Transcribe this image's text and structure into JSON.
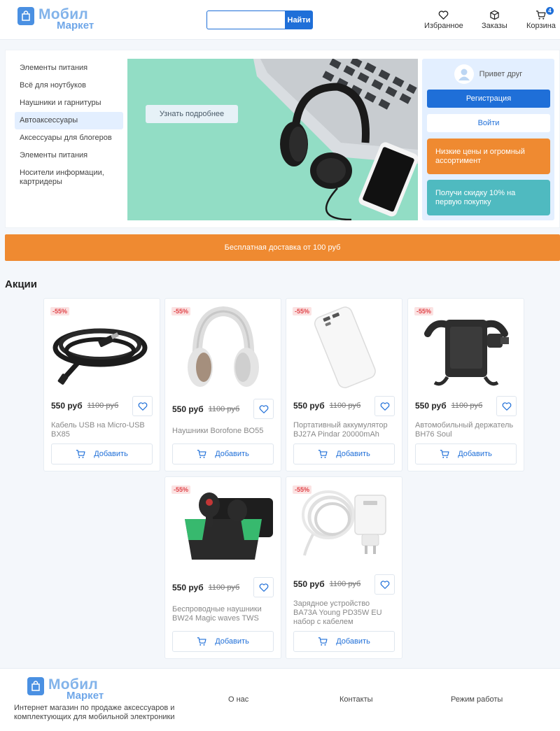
{
  "header": {
    "logo_line1": "Мобил",
    "logo_line2": "Маркет",
    "search_value": "",
    "search_button": "Найти",
    "favorites_label": "Избранное",
    "orders_label": "Заказы",
    "cart_label": "Корзина",
    "cart_count": "4"
  },
  "categories": [
    "Элементы питания",
    "Всё для ноутбуков",
    "Наушники и гарнитуры",
    "Автоаксессуары",
    "Аксессуары для блогеров",
    "Элементы питания",
    "Носители информации, картридеры"
  ],
  "active_category_index": 3,
  "banner": {
    "button_label": "Узнать подробнее"
  },
  "side_panel": {
    "greeting": "Привет друг",
    "register_label": "Регистрация",
    "login_label": "Войти",
    "promo1": "Низкие цены и огромный ассортимент",
    "promo2": "Получи скидку 10% на первую покупку"
  },
  "delivery_banner": "Бесплатная доставка от 100 руб",
  "section_title": "Акции",
  "products": [
    {
      "discount": "-55%",
      "price": "550 руб",
      "old_price": "1100 руб",
      "name": "Кабель USB на Micro-USB BX85",
      "add_label": "Добавить",
      "image": "cable"
    },
    {
      "discount": "-55%",
      "price": "550 руб",
      "old_price": "1100 руб",
      "name": "Наушники Borofone BO55",
      "add_label": "Добавить",
      "image": "headphones"
    },
    {
      "discount": "-55%",
      "price": "550 руб",
      "old_price": "1100 руб",
      "name": "Портативный аккумулятор BJ27A Pindar 20000mAh",
      "add_label": "Добавить",
      "image": "powerbank"
    },
    {
      "discount": "-55%",
      "price": "550 руб",
      "old_price": "1100 руб",
      "name": "Автомобильный держатель BH76 Soul",
      "add_label": "Добавить",
      "image": "car-holder"
    },
    {
      "discount": "-55%",
      "price": "550 руб",
      "old_price": "1100 руб",
      "name": "Беспроводные наушники BW24 Magic waves TWS",
      "add_label": "Добавить",
      "image": "earbuds"
    },
    {
      "discount": "-55%",
      "price": "550 руб",
      "old_price": "1100 руб",
      "name": "Зарядное устройство BA73A Young PD35W EU набор с кабелем",
      "add_label": "Добавить",
      "image": "charger"
    }
  ],
  "footer": {
    "logo_line1": "Мобил",
    "logo_line2": "Маркет",
    "description": "Интернет магазин по продаже аксессуаров и комплектующих для мобильной электроники",
    "link_about": "О нас",
    "link_contacts": "Контакты",
    "link_hours": "Режим работы"
  },
  "colors": {
    "primary": "#1f6fd8",
    "orange": "#ef8a31",
    "teal": "#4fbac0",
    "banner_bg": "#92ddc5",
    "discount": "#e0454a"
  }
}
